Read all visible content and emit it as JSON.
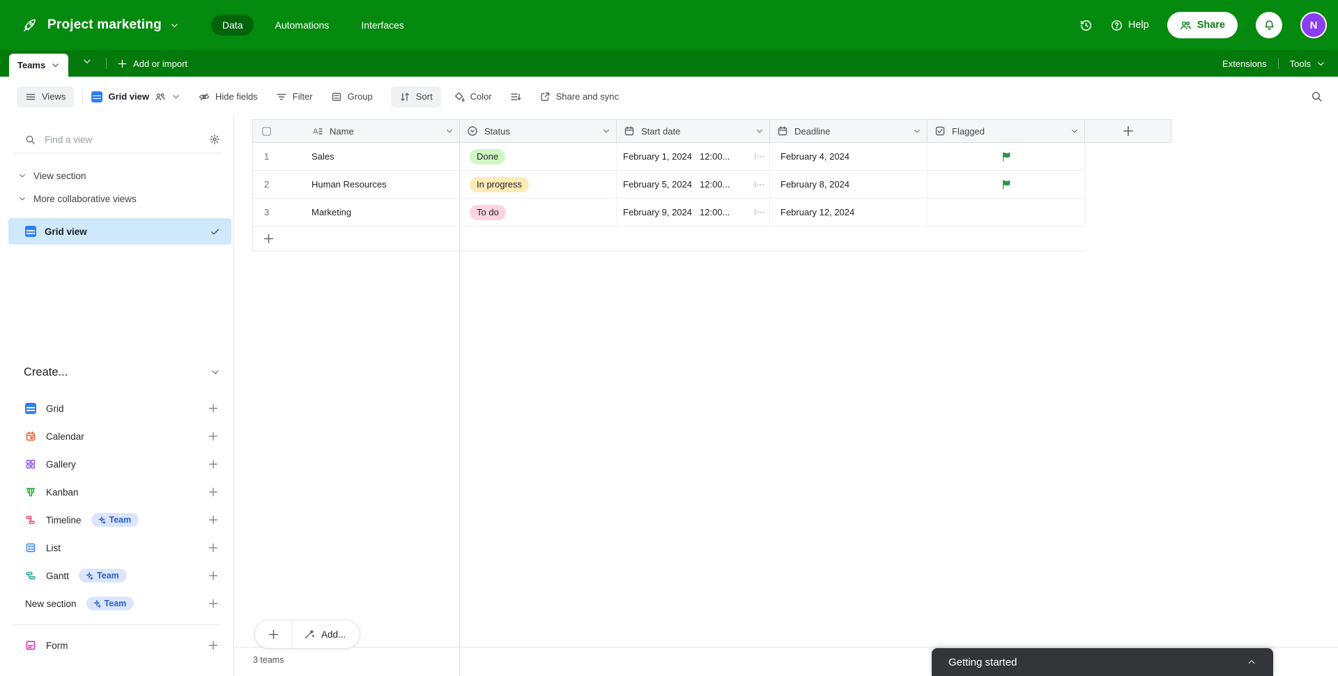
{
  "topbar": {
    "app_name": "Project marketing",
    "tabs": [
      {
        "label": "Data",
        "active": true
      },
      {
        "label": "Automations",
        "active": false
      },
      {
        "label": "Interfaces",
        "active": false
      }
    ],
    "help_label": "Help",
    "share_label": "Share",
    "avatar_initial": "N"
  },
  "tabbar": {
    "table_tab": "Teams",
    "add_label": "Add or import",
    "extensions_label": "Extensions",
    "tools_label": "Tools"
  },
  "toolbar": {
    "views_label": "Views",
    "view_name": "Grid view",
    "hide_fields_label": "Hide fields",
    "filter_label": "Filter",
    "group_label": "Group",
    "sort_label": "Sort",
    "color_label": "Color",
    "share_sync_label": "Share and sync"
  },
  "sidebar": {
    "find_placeholder": "Find a view",
    "sections": [
      "View section",
      "More collaborative views"
    ],
    "selected_view": "Grid view",
    "create_label": "Create...",
    "create_items": [
      {
        "label": "Grid",
        "badge": null
      },
      {
        "label": "Calendar",
        "badge": null
      },
      {
        "label": "Gallery",
        "badge": null
      },
      {
        "label": "Kanban",
        "badge": null
      },
      {
        "label": "Timeline",
        "badge": "Team"
      },
      {
        "label": "List",
        "badge": null
      },
      {
        "label": "Gantt",
        "badge": "Team"
      },
      {
        "label": "New section",
        "badge": "Team"
      },
      {
        "label": "Form",
        "badge": null
      }
    ]
  },
  "grid": {
    "columns": [
      {
        "label": "Name"
      },
      {
        "label": "Status"
      },
      {
        "label": "Start date"
      },
      {
        "label": "Deadline"
      },
      {
        "label": "Flagged"
      }
    ],
    "rows": [
      {
        "num": "1",
        "name": "Sales",
        "status": "Done",
        "status_bg": "#d1f7c4",
        "start_date": "February 1, 2024",
        "start_time": "12:00...",
        "deadline": "February 4, 2024",
        "flagged": true
      },
      {
        "num": "2",
        "name": "Human Resources",
        "status": "In progress",
        "status_bg": "#ffeab6",
        "start_date": "February 5, 2024",
        "start_time": "12:00...",
        "deadline": "February 8, 2024",
        "flagged": true
      },
      {
        "num": "3",
        "name": "Marketing",
        "status": "To do",
        "status_bg": "#ffd4e0",
        "start_date": "February 9, 2024",
        "start_time": "12:00...",
        "deadline": "February 12, 2024",
        "flagged": false
      }
    ],
    "add_button_label": "Add...",
    "summary": "3 teams"
  },
  "toast": {
    "title": "Getting started"
  },
  "colors": {
    "topbar_green": "#048a0e",
    "tabbar_green": "#037a0b",
    "selected_view_bg": "#cfe9fb",
    "status_done": "#d1f7c4",
    "status_in_progress": "#ffeab6",
    "status_todo": "#ffd4e0",
    "flag_green": "#2d9644",
    "avatar_purple": "#8b3df2",
    "accent_blue": "#2d7ff9"
  }
}
